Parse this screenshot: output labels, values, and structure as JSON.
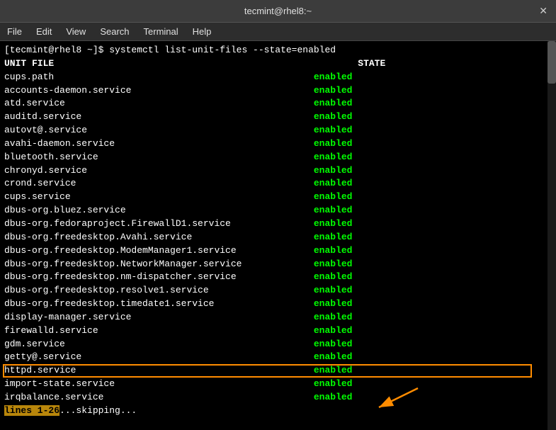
{
  "titlebar": {
    "title": "tecmint@rhel8:~",
    "close_symbol": "✕"
  },
  "menubar": {
    "items": [
      "File",
      "Edit",
      "View",
      "Search",
      "Terminal",
      "Help"
    ]
  },
  "terminal": {
    "command_line": "[tecmint@rhel8 ~]$ systemctl list-unit-files --state=enabled",
    "header": {
      "col1": "UNIT FILE",
      "col2": "STATE"
    },
    "rows": [
      {
        "unit": "cups.path",
        "state": "enabled"
      },
      {
        "unit": "accounts-daemon.service",
        "state": "enabled"
      },
      {
        "unit": "atd.service",
        "state": "enabled"
      },
      {
        "unit": "auditd.service",
        "state": "enabled"
      },
      {
        "unit": "autovt@.service",
        "state": "enabled"
      },
      {
        "unit": "avahi-daemon.service",
        "state": "enabled"
      },
      {
        "unit": "bluetooth.service",
        "state": "enabled"
      },
      {
        "unit": "chronyd.service",
        "state": "enabled"
      },
      {
        "unit": "crond.service",
        "state": "enabled"
      },
      {
        "unit": "cups.service",
        "state": "enabled"
      },
      {
        "unit": "dbus-org.bluez.service",
        "state": "enabled"
      },
      {
        "unit": "dbus-org.fedoraproject.FirewallD1.service",
        "state": "enabled"
      },
      {
        "unit": "dbus-org.freedesktop.Avahi.service",
        "state": "enabled"
      },
      {
        "unit": "dbus-org.freedesktop.ModemManager1.service",
        "state": "enabled"
      },
      {
        "unit": "dbus-org.freedesktop.NetworkManager.service",
        "state": "enabled"
      },
      {
        "unit": "dbus-org.freedesktop.nm-dispatcher.service",
        "state": "enabled"
      },
      {
        "unit": "dbus-org.freedesktop.resolve1.service",
        "state": "enabled"
      },
      {
        "unit": "dbus-org.freedesktop.timedate1.service",
        "state": "enabled"
      },
      {
        "unit": "display-manager.service",
        "state": "enabled"
      },
      {
        "unit": "firewalld.service",
        "state": "enabled"
      },
      {
        "unit": "gdm.service",
        "state": "enabled"
      },
      {
        "unit": "getty@.service",
        "state": "enabled"
      },
      {
        "unit": "httpd.service",
        "state": "enabled",
        "highlighted": true
      },
      {
        "unit": "import-state.service",
        "state": "enabled"
      },
      {
        "unit": "irqbalance.service",
        "state": "enabled"
      }
    ],
    "status_line": "lines 1-26...skipping..."
  }
}
